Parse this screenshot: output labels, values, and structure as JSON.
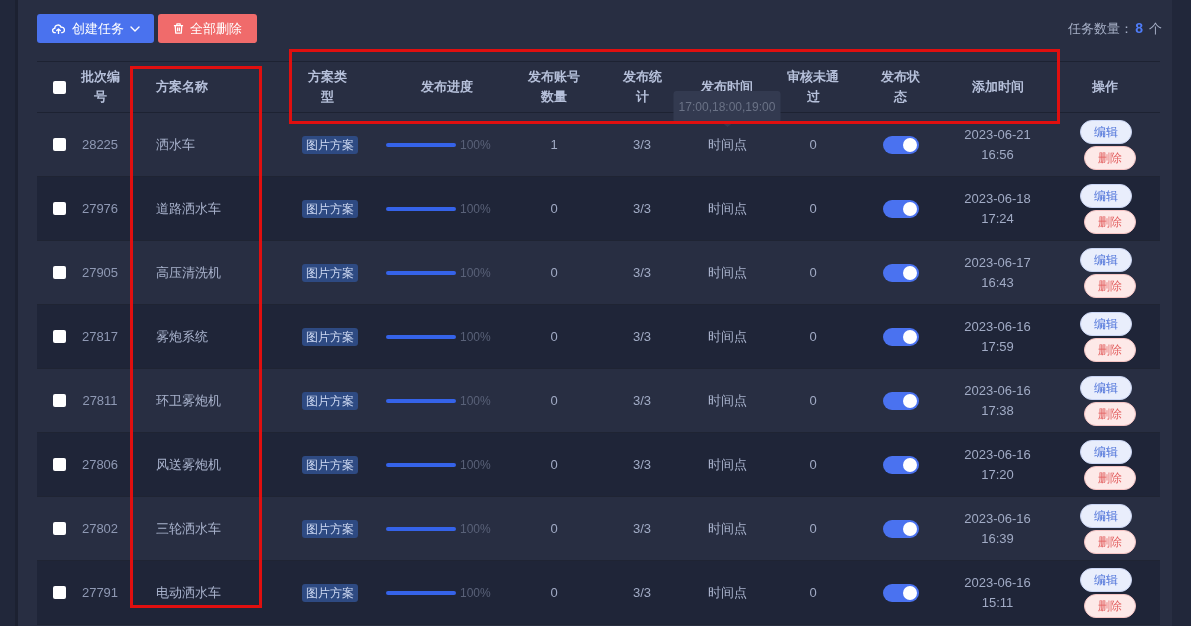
{
  "toolbar": {
    "buttons": [
      {
        "kind": "create",
        "label": "创建任务"
      },
      {
        "kind": "delete_all",
        "label": "全部删除"
      }
    ],
    "task_count": {
      "label": "任务数量：",
      "value": "8",
      "unit": "个"
    }
  },
  "table": {
    "select_all": {
      "checked": false
    },
    "header_framed": true,
    "columns": [
      {
        "label": "批次编号",
        "framed": false
      },
      {
        "label": "方案名称",
        "framed": true
      },
      {
        "label": "方案类型",
        "framed": false
      },
      {
        "label": "发布进度",
        "framed": false
      },
      {
        "label": "发布账号数量",
        "framed": false
      },
      {
        "label": "发布统计",
        "framed": false
      },
      {
        "label": "发布时间",
        "framed": false
      },
      {
        "label": "审核未通过",
        "framed": false
      },
      {
        "label": "发布状态",
        "framed": false
      },
      {
        "label": "添加时间",
        "framed": false
      },
      {
        "label": "操作",
        "framed": false
      }
    ],
    "rows": [
      {
        "checked": false,
        "id": "28225",
        "name": "洒水车",
        "type": "图片方案",
        "progress": {
          "level": 1,
          "label": "100%"
        },
        "accounts": "1",
        "stats": "3/3",
        "publish_time": "时间点",
        "tooltip": "17:00,18:00,19:00",
        "rejected": "0",
        "on": true,
        "added": {
          "date": "2023-06-21",
          "time": "16:56"
        },
        "actions": [
          {
            "kind": "edit",
            "label": "编辑"
          },
          {
            "kind": "delete",
            "label": "删除"
          }
        ]
      },
      {
        "checked": false,
        "id": "27976",
        "name": "道路洒水车",
        "type": "图片方案",
        "progress": {
          "level": 1,
          "label": "100%"
        },
        "accounts": "0",
        "stats": "3/3",
        "publish_time": "时间点",
        "rejected": "0",
        "on": true,
        "added": {
          "date": "2023-06-18",
          "time": "17:24"
        },
        "actions": [
          {
            "kind": "edit",
            "label": "编辑"
          },
          {
            "kind": "delete",
            "label": "删除"
          }
        ]
      },
      {
        "checked": false,
        "id": "27905",
        "name": "高压清洗机",
        "type": "图片方案",
        "progress": {
          "level": 1,
          "label": "100%"
        },
        "accounts": "0",
        "stats": "3/3",
        "publish_time": "时间点",
        "rejected": "0",
        "on": true,
        "added": {
          "date": "2023-06-17",
          "time": "16:43"
        },
        "actions": [
          {
            "kind": "edit",
            "label": "编辑"
          },
          {
            "kind": "delete",
            "label": "删除"
          }
        ]
      },
      {
        "checked": false,
        "id": "27817",
        "name": "雾炮系统",
        "type": "图片方案",
        "progress": {
          "level": 1,
          "label": "100%"
        },
        "accounts": "0",
        "stats": "3/3",
        "publish_time": "时间点",
        "rejected": "0",
        "on": true,
        "added": {
          "date": "2023-06-16",
          "time": "17:59"
        },
        "actions": [
          {
            "kind": "edit",
            "label": "编辑"
          },
          {
            "kind": "delete",
            "label": "删除"
          }
        ]
      },
      {
        "checked": false,
        "id": "27811",
        "name": "环卫雾炮机",
        "type": "图片方案",
        "progress": {
          "level": 1,
          "label": "100%"
        },
        "accounts": "0",
        "stats": "3/3",
        "publish_time": "时间点",
        "rejected": "0",
        "on": true,
        "added": {
          "date": "2023-06-16",
          "time": "17:38"
        },
        "actions": [
          {
            "kind": "edit",
            "label": "编辑"
          },
          {
            "kind": "delete",
            "label": "删除"
          }
        ]
      },
      {
        "checked": false,
        "id": "27806",
        "name": "风送雾炮机",
        "type": "图片方案",
        "progress": {
          "level": 1,
          "label": "100%"
        },
        "accounts": "0",
        "stats": "3/3",
        "publish_time": "时间点",
        "rejected": "0",
        "on": true,
        "added": {
          "date": "2023-06-16",
          "time": "17:20"
        },
        "actions": [
          {
            "kind": "edit",
            "label": "编辑"
          },
          {
            "kind": "delete",
            "label": "删除"
          }
        ]
      },
      {
        "checked": false,
        "id": "27802",
        "name": "三轮洒水车",
        "type": "图片方案",
        "progress": {
          "level": 1,
          "label": "100%"
        },
        "accounts": "0",
        "stats": "3/3",
        "publish_time": "时间点",
        "rejected": "0",
        "on": true,
        "added": {
          "date": "2023-06-16",
          "time": "16:39"
        },
        "actions": [
          {
            "kind": "edit",
            "label": "编辑"
          },
          {
            "kind": "delete",
            "label": "删除"
          }
        ]
      },
      {
        "checked": false,
        "id": "27791",
        "name": "电动洒水车",
        "type": "图片方案",
        "progress": {
          "level": 1,
          "label": "100%"
        },
        "accounts": "0",
        "stats": "3/3",
        "publish_time": "时间点",
        "rejected": "0",
        "on": true,
        "added": {
          "date": "2023-06-16",
          "time": "15:11"
        },
        "actions": [
          {
            "kind": "edit",
            "label": "编辑"
          },
          {
            "kind": "delete",
            "label": "删除"
          }
        ]
      }
    ]
  }
}
